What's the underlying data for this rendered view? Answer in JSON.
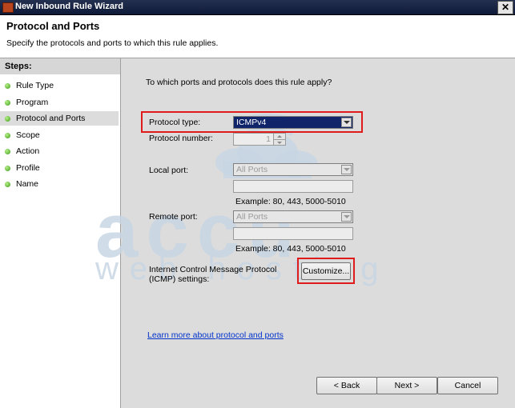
{
  "window": {
    "title": "New Inbound Rule Wizard",
    "close_glyph": "✕"
  },
  "header": {
    "title": "Protocol and Ports",
    "subtitle": "Specify the protocols and ports to which this rule applies."
  },
  "steps": {
    "title": "Steps:",
    "items": [
      {
        "label": "Rule Type"
      },
      {
        "label": "Program"
      },
      {
        "label": "Protocol and Ports"
      },
      {
        "label": "Scope"
      },
      {
        "label": "Action"
      },
      {
        "label": "Profile"
      },
      {
        "label": "Name"
      }
    ],
    "active_index": 2
  },
  "main": {
    "question": "To which ports and protocols does this rule apply?",
    "protocol_type": {
      "label": "Protocol type:",
      "value": "ICMPv4"
    },
    "protocol_number": {
      "label": "Protocol number:",
      "value": "1"
    },
    "local_port": {
      "label": "Local port:",
      "value": "All Ports",
      "example": "Example: 80, 443, 5000-5010"
    },
    "remote_port": {
      "label": "Remote port:",
      "value": "All Ports",
      "example": "Example: 80, 443, 5000-5010"
    },
    "icmp": {
      "label_line1": "Internet Control Message Protocol",
      "label_line2": "(ICMP) settings:",
      "customize_label": "Customize..."
    },
    "learn_more": "Learn more about protocol and ports"
  },
  "footer": {
    "back_label": "< Back",
    "next_label": "Next >",
    "cancel_label": "Cancel"
  },
  "watermark": {
    "line1": "accu",
    "line2": "web hosting"
  },
  "colors": {
    "highlight": "#e01b1b",
    "selection": "#10246a",
    "link": "#0033cc",
    "watermark": "#c8d6e4"
  }
}
